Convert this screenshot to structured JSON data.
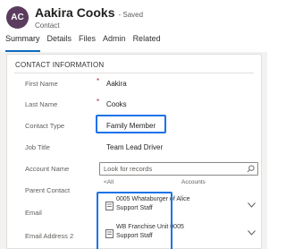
{
  "header": {
    "avatar_initials": "AC",
    "record_name": "Aakira Cooks",
    "saved_status": "- Saved",
    "record_type": "Contact"
  },
  "tabs": [
    {
      "label": "Summary",
      "active": true
    },
    {
      "label": "Details",
      "active": false
    },
    {
      "label": "Files",
      "active": false
    },
    {
      "label": "Admin",
      "active": false
    },
    {
      "label": "Related",
      "active": false
    }
  ],
  "section": {
    "title": "CONTACT INFORMATION",
    "fields": [
      {
        "label": "First Name",
        "required": true,
        "value": "Aakira"
      },
      {
        "label": "Last Name",
        "required": true,
        "value": "Cooks"
      },
      {
        "label": "Contact Type",
        "required": false,
        "value": "Family Member"
      },
      {
        "label": "Job Title",
        "required": false,
        "value": "Team Lead Driver"
      },
      {
        "label": "Account Name",
        "required": false,
        "value": ""
      },
      {
        "label": "Parent Contact",
        "required": false,
        "value": ""
      },
      {
        "label": "Email",
        "required": false,
        "value": ""
      },
      {
        "label": "Email Address 2",
        "required": false,
        "value": ""
      }
    ],
    "required_marker": "*"
  },
  "lookup": {
    "placeholder": "Look for records",
    "filter_all": "All",
    "filter_entity": "Accounts",
    "results": [
      {
        "name": "0005 Whataburger of Alice",
        "subtitle": "Support Staff"
      },
      {
        "name": "WB Franchise Unit 0005",
        "subtitle": "Support Staff"
      }
    ]
  },
  "colors": {
    "accent": "#0f6cbd",
    "highlight": "#1a73e8",
    "avatar": "#5b3b5e",
    "required": "#a4262c"
  }
}
